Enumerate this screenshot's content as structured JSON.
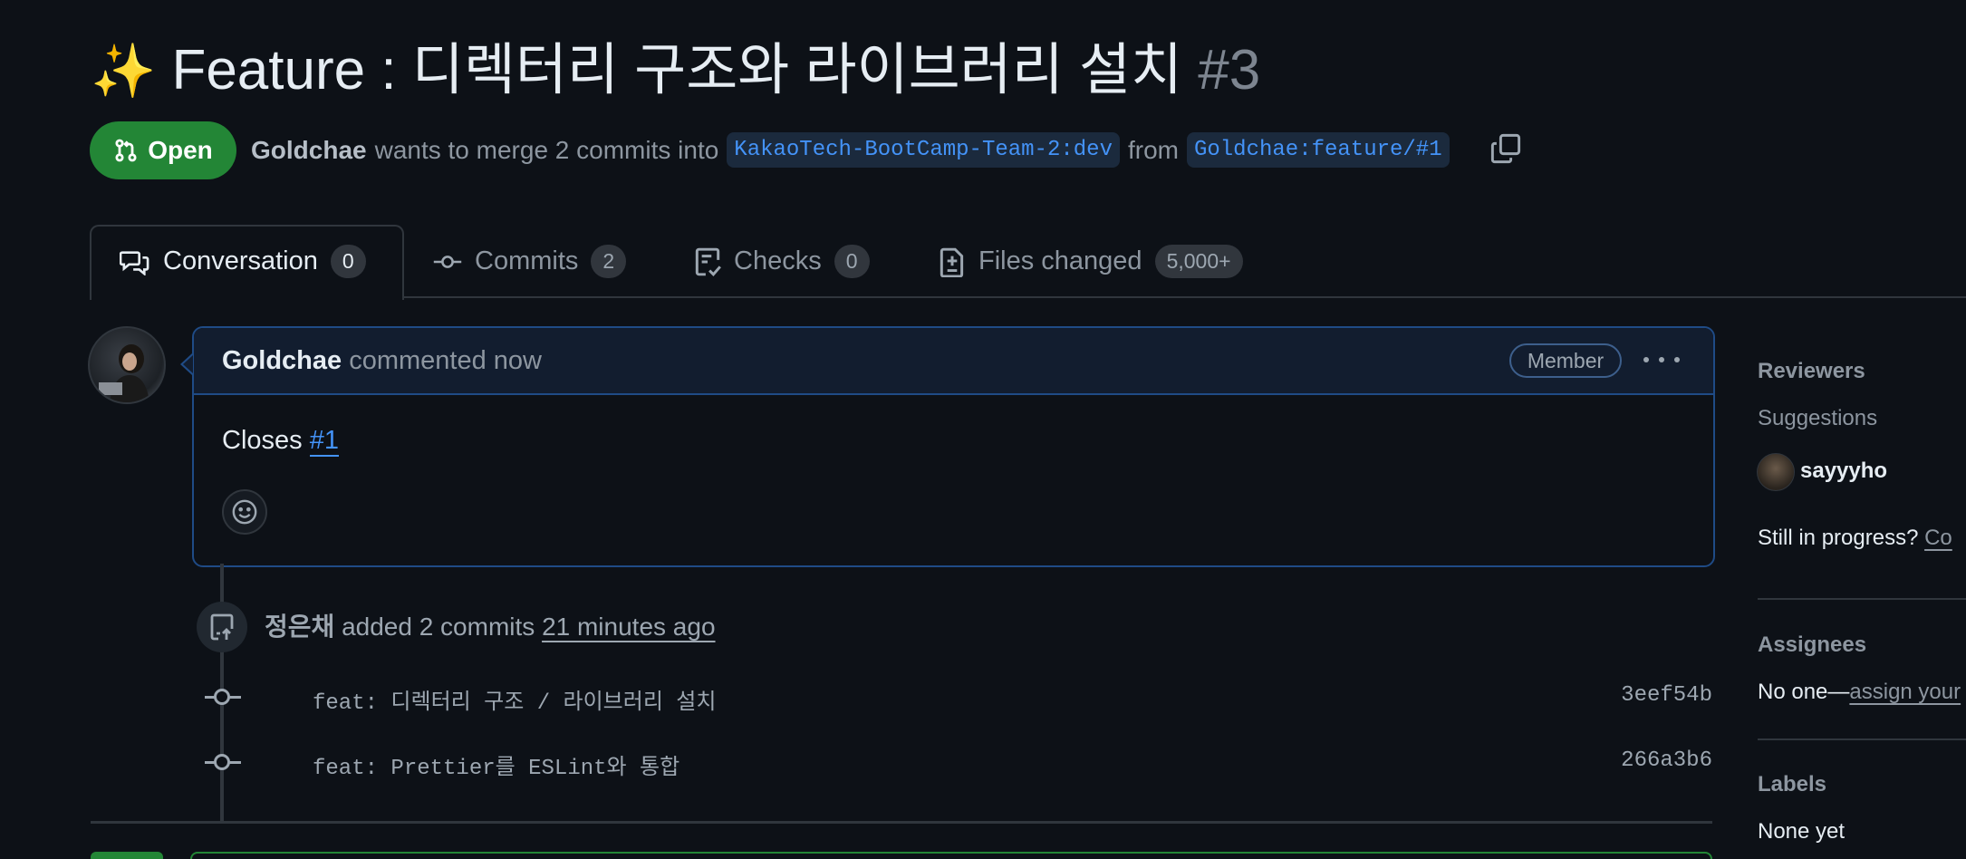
{
  "header": {
    "title_emoji": "✨",
    "title_text": "Feature : 디렉터리 구조와 라이브러리 설치",
    "pr_number": "#3",
    "state_label": "Open",
    "author": "Goldchae",
    "merge_text": "wants to merge 2 commits into",
    "base_branch": "KakaoTech-BootCamp-Team-2:dev",
    "from_text": "from",
    "head_branch": "Goldchae:feature/#1"
  },
  "tabs": [
    {
      "label": "Conversation",
      "count": "0",
      "icon": "comment-discussion-icon"
    },
    {
      "label": "Commits",
      "count": "2",
      "icon": "git-commit-icon"
    },
    {
      "label": "Checks",
      "count": "0",
      "icon": "checklist-icon"
    },
    {
      "label": "Files changed",
      "count": "5,000+",
      "icon": "file-diff-icon"
    }
  ],
  "comment": {
    "author": "Goldchae",
    "action": "commented now",
    "role_badge": "Member",
    "body_prefix": "Closes",
    "body_link": "#1"
  },
  "timeline": {
    "push_author": "정은채",
    "push_text": "added 2 commits",
    "push_time": "21 minutes ago",
    "commits": [
      {
        "message": "feat: 디렉터리 구조 / 라이브러리 설치",
        "sha": "3eef54b"
      },
      {
        "message": "feat: Prettier를 ESLint와 통합",
        "sha": "266a3b6"
      }
    ]
  },
  "sidebar": {
    "reviewers_heading": "Reviewers",
    "suggestions_label": "Suggestions",
    "suggested_reviewer": "sayyyho",
    "in_progress_text": "Still in progress?",
    "in_progress_link": "Co",
    "assignees_heading": "Assignees",
    "assignees_none": "No one—",
    "assignees_link": "assign your",
    "labels_heading": "Labels",
    "labels_none": "None yet"
  },
  "colors": {
    "background": "#0d1117",
    "open_green": "#238636",
    "link_blue": "#4493f8",
    "comment_border": "#1f4b86"
  }
}
